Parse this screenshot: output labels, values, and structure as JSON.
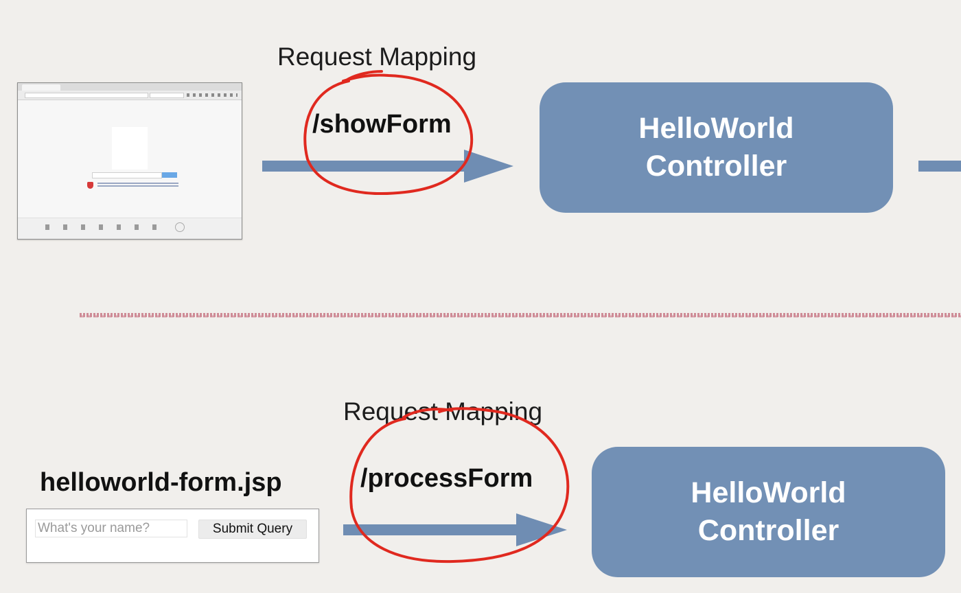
{
  "top_flow": {
    "mapping_label": "Request Mapping",
    "path": "/showForm",
    "controller_line1": "HelloWorld",
    "controller_line2": "Controller"
  },
  "bottom_flow": {
    "mapping_label": "Request Mapping",
    "path": "/processForm",
    "controller_line1": "HelloWorld",
    "controller_line2": "Controller",
    "form_title": "helloworld-form.jsp",
    "name_placeholder": "What's your name?",
    "submit_label": "Submit Query"
  },
  "colors": {
    "background": "#f1efec",
    "controller_fill": "#7290b5",
    "arrow": "#6f8db3",
    "annotation_red": "#e0291f",
    "divider": "#c97a88"
  }
}
